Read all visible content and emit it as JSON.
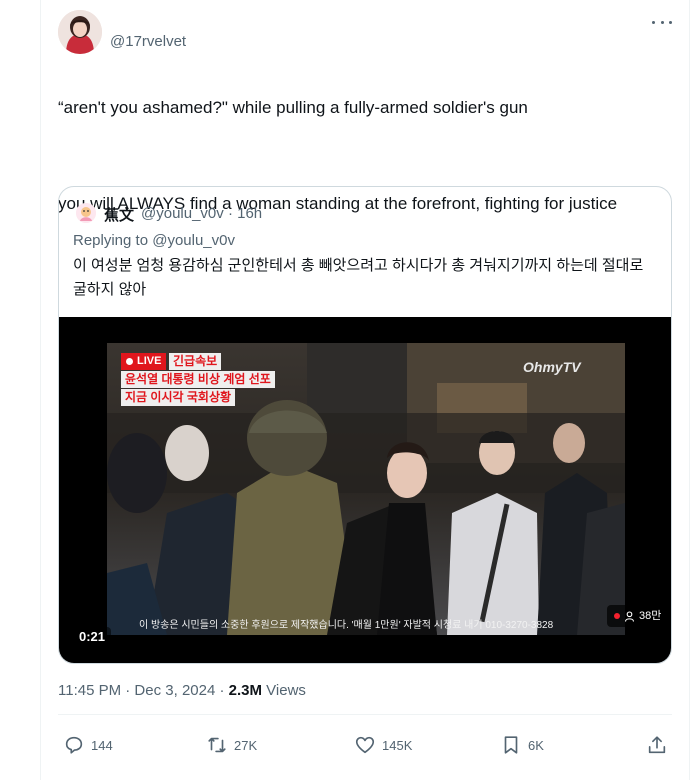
{
  "tweet": {
    "handle": "@17rvelvet",
    "line1": "“aren't you ashamed?\" while pulling a fully-armed soldier's gun",
    "line2": "you will ALWAYS find a woman standing at the forefront, fighting for justice"
  },
  "quote": {
    "name": "蕉文",
    "handle_time": "@youlu_v0v · 16h",
    "replying_prefix": "Replying to",
    "replying_handle": "@youlu_v0v",
    "text": "이 여성분 엄청 용감하심 군인한테서 총 빼앗으려고 하시다가 총 겨눠지기까지 하는데 절대로 굴하지 않아"
  },
  "video": {
    "live_label": "LIVE",
    "banner1": "긴급속보",
    "banner2": "윤석열 대통령 비상 계엄 선포",
    "banner3": "지금 이시각 국회상황",
    "watermark": "OhmyTV",
    "caption": "이 방송은 시민들의 소중한 후원으로 제작했습니다. '매월 1만원' 자발적 시청료 내기 010-3270-3828",
    "timecode": "0:21",
    "viewers": "38만"
  },
  "meta": {
    "time_date": "11:45 PM · Dec 3, 2024 · ",
    "views_count": "2.3M",
    "views_label": " Views"
  },
  "actions": {
    "replies": "144",
    "reposts": "27K",
    "likes": "145K",
    "bookmarks": "6K"
  },
  "colors": {
    "text_primary": "#0f1419",
    "text_secondary": "#536471",
    "border": "#cfd9de",
    "live_red": "#e0161d"
  },
  "icons": [
    "more-icon",
    "reply-icon",
    "repost-icon",
    "like-icon",
    "bookmark-icon",
    "share-icon"
  ]
}
